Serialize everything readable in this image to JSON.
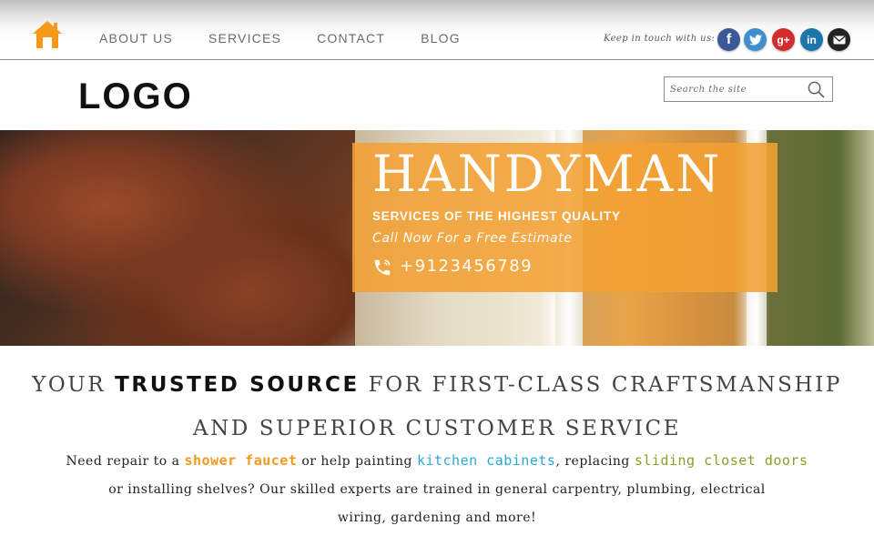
{
  "nav": {
    "items": [
      "ABOUT US",
      "SERVICES",
      "CONTACT",
      "BLOG"
    ],
    "keep_in_touch": "Keep in touch with us:",
    "social": [
      "facebook",
      "twitter",
      "google-plus",
      "linkedin",
      "email"
    ],
    "social_glyphs": {
      "facebook": "f",
      "google_plus": "g+",
      "linkedin": "in"
    }
  },
  "header": {
    "logo": "LOGO",
    "search_placeholder": "Search the site"
  },
  "hero": {
    "title": "HANDYMAN",
    "tagline": "SERVICES OF THE HIGHEST QUALITY",
    "call": "Call Now For a Free Estimate",
    "phone": "+9123456789"
  },
  "content": {
    "headline_part1": "YOUR ",
    "headline_strong": "TRUSTED SOURCE",
    "headline_part2": " FOR FIRST-CLASS CRAFTSMANSHIP",
    "headline_line2": "AND SUPERIOR CUSTOMER SERVICE",
    "p1": "Need repair to a ",
    "link1": "shower faucet",
    "p2": " or help painting ",
    "link2": "kitchen cabinets",
    "p3": ", replacing ",
    "link3": "sliding closet doors",
    "p4": "or installing shelves? Our skilled experts are trained in general carpentry, plumbing, electrical",
    "p5": "wiring, gardening and more!"
  },
  "colors": {
    "accent_orange": "#f3a033",
    "link_orange": "#f39a1a",
    "link_blue": "#2ba7d8",
    "link_olive": "#8b9e28"
  }
}
